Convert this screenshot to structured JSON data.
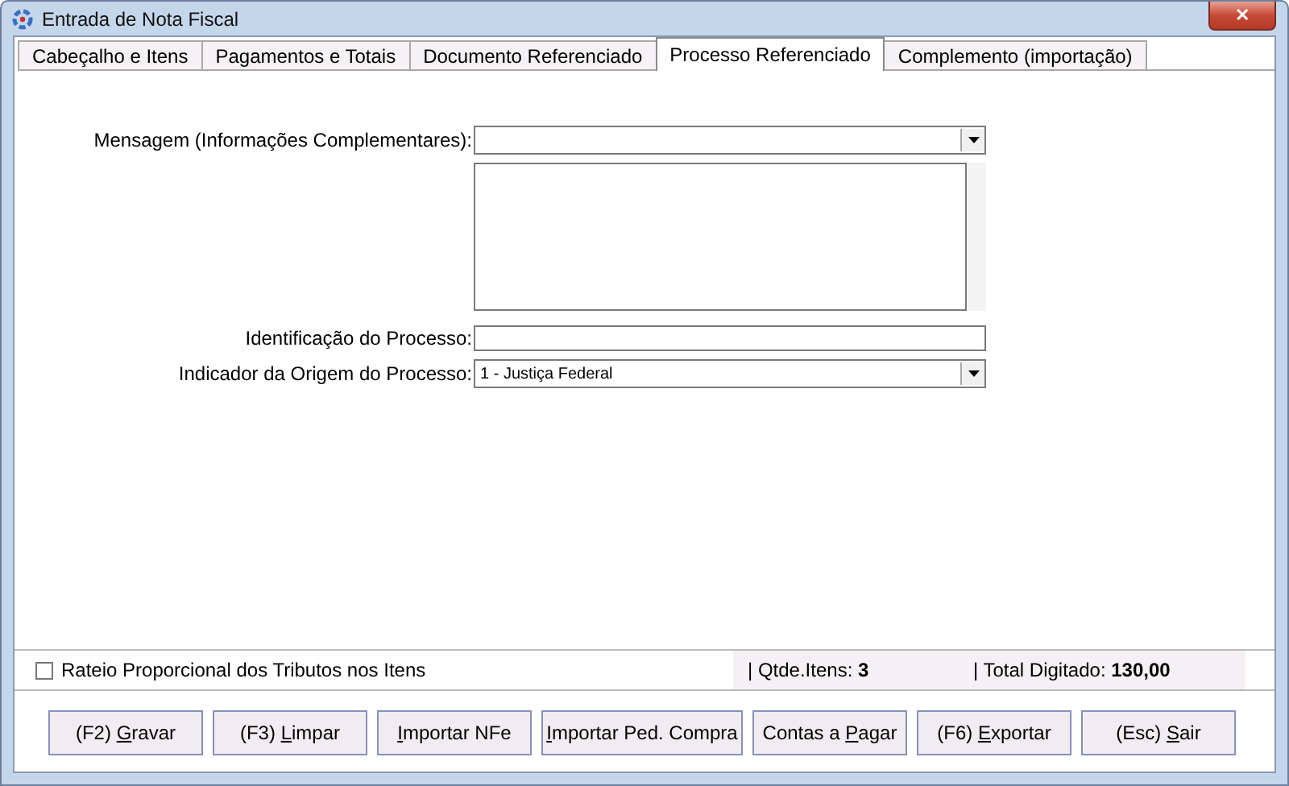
{
  "window": {
    "title": "Entrada de Nota Fiscal",
    "close": "✕"
  },
  "tabs": [
    {
      "label": "Cabeçalho e Itens",
      "selected": false
    },
    {
      "label": "Pagamentos e Totais",
      "selected": false
    },
    {
      "label": "Documento Referenciado",
      "selected": false
    },
    {
      "label": "Processo Referenciado",
      "selected": true
    },
    {
      "label": "Complemento (importação)",
      "selected": false
    }
  ],
  "form": {
    "message_label": "Mensagem (Informações Complementares):",
    "process_id_label": "Identificação do Processo:",
    "origin_label": "Indicador da Origem do Processo:",
    "origin_value": "1 - Justiça Federal"
  },
  "footer": {
    "prorate": {
      "label": "Rateio Proporcional dos Tributos nos Itens",
      "checked": false
    },
    "item_count": "| Qtde.Itens: **3**",
    "total": "| Total Digitado: **130,00**"
  },
  "buttons": [
    {
      "before": "(F2) ",
      "key": "G",
      "after": "ravar"
    },
    {
      "before": "(F3) ",
      "key": "L",
      "after": "impar"
    },
    {
      "key": "I",
      "after": "mportar NFe"
    },
    {
      "key": "I",
      "after": "mportar Ped. Compra"
    },
    {
      "before": "Contas a ",
      "key": "P",
      "after": "agar"
    },
    {
      "before": "(F6) ",
      "key": "E",
      "after": "xportar"
    },
    {
      "before": "(Esc) ",
      "key": "S",
      "after": "air"
    }
  ]
}
